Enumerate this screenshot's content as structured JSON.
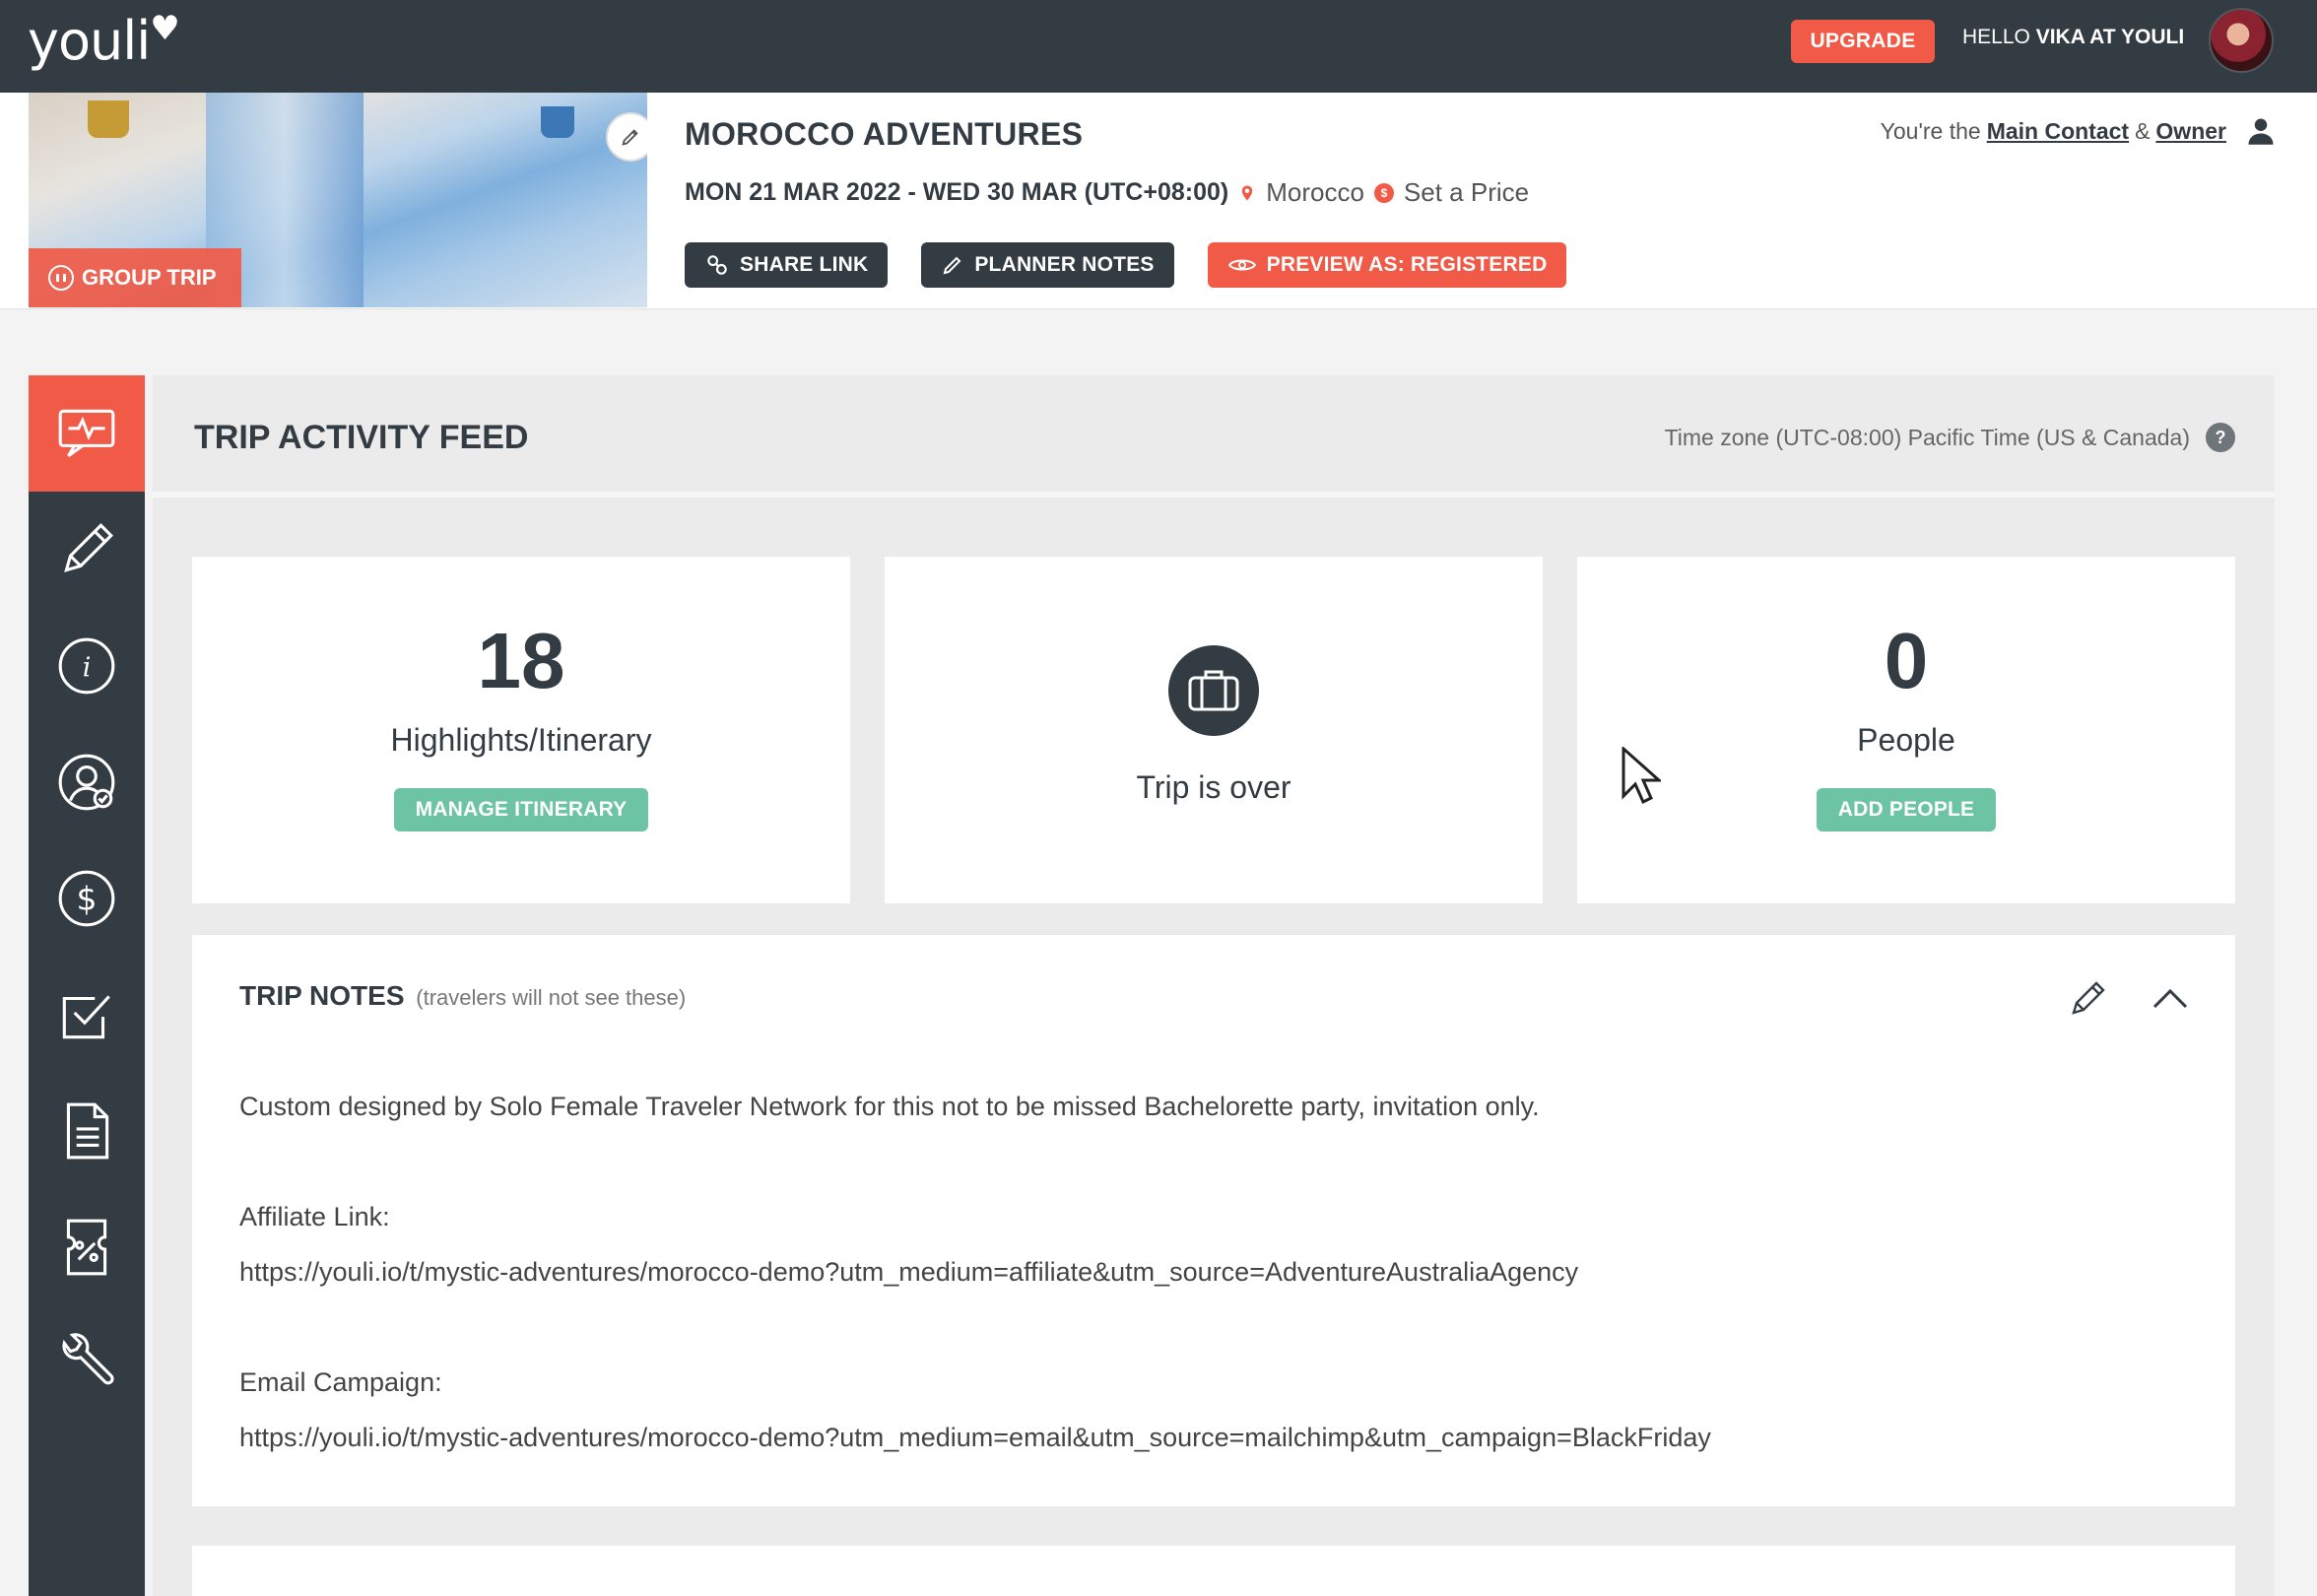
{
  "app": {
    "logo": "youli"
  },
  "topbar": {
    "upgrade_label": "UPGRADE",
    "greeting_prefix": "HELLO ",
    "greeting_name": "VIKA AT YOULI"
  },
  "trip": {
    "title": "MOROCCO ADVENTURES",
    "dates": "MON 21 MAR 2022 - WED 30 MAR (UTC+08:00)",
    "location": "Morocco",
    "price_label": "Set a Price",
    "badge": "GROUP TRIP",
    "role_prefix": "You're the",
    "role_contact": "Main Contact",
    "role_amp": "&",
    "role_owner": "Owner",
    "actions": {
      "share": "SHARE LINK",
      "notes": "PLANNER NOTES",
      "preview": "PREVIEW AS: REGISTERED"
    }
  },
  "feed": {
    "title": "TRIP ACTIVITY FEED",
    "timezone": "Time zone (UTC-08:00) Pacific Time (US & Canada)",
    "help": "?"
  },
  "stats": {
    "itinerary": {
      "count": "18",
      "label": "Highlights/Itinerary",
      "button": "MANAGE ITINERARY"
    },
    "status": {
      "label": "Trip is over"
    },
    "people": {
      "count": "0",
      "label": "People",
      "button": "ADD PEOPLE"
    }
  },
  "notes": {
    "title": "TRIP NOTES",
    "subtitle": "(travelers will not see these)",
    "line1": "Custom designed by Solo Female Traveler Network for this not to be missed Bachelorette party, invitation only.",
    "affiliate_label": "Affiliate Link:",
    "affiliate_url": "https://youli.io/t/mystic-adventures/morocco-demo?utm_medium=affiliate&utm_source=AdventureAustraliaAgency",
    "email_label": "Email Campaign:",
    "email_url": "https://youli.io/t/mystic-adventures/morocco-demo?utm_medium=email&utm_source=mailchimp&utm_campaign=BlackFriday"
  },
  "sidebar": {
    "items": [
      {
        "icon": "activity-feed-icon",
        "active": true
      },
      {
        "icon": "pencil-icon"
      },
      {
        "icon": "info-icon"
      },
      {
        "icon": "user-check-icon"
      },
      {
        "icon": "dollar-icon"
      },
      {
        "icon": "checkbox-icon"
      },
      {
        "icon": "document-icon"
      },
      {
        "icon": "coupon-icon"
      },
      {
        "icon": "wrench-icon"
      }
    ]
  },
  "colors": {
    "dark": "#333c43",
    "accent": "#f05a47",
    "green": "#6cc4a4"
  }
}
